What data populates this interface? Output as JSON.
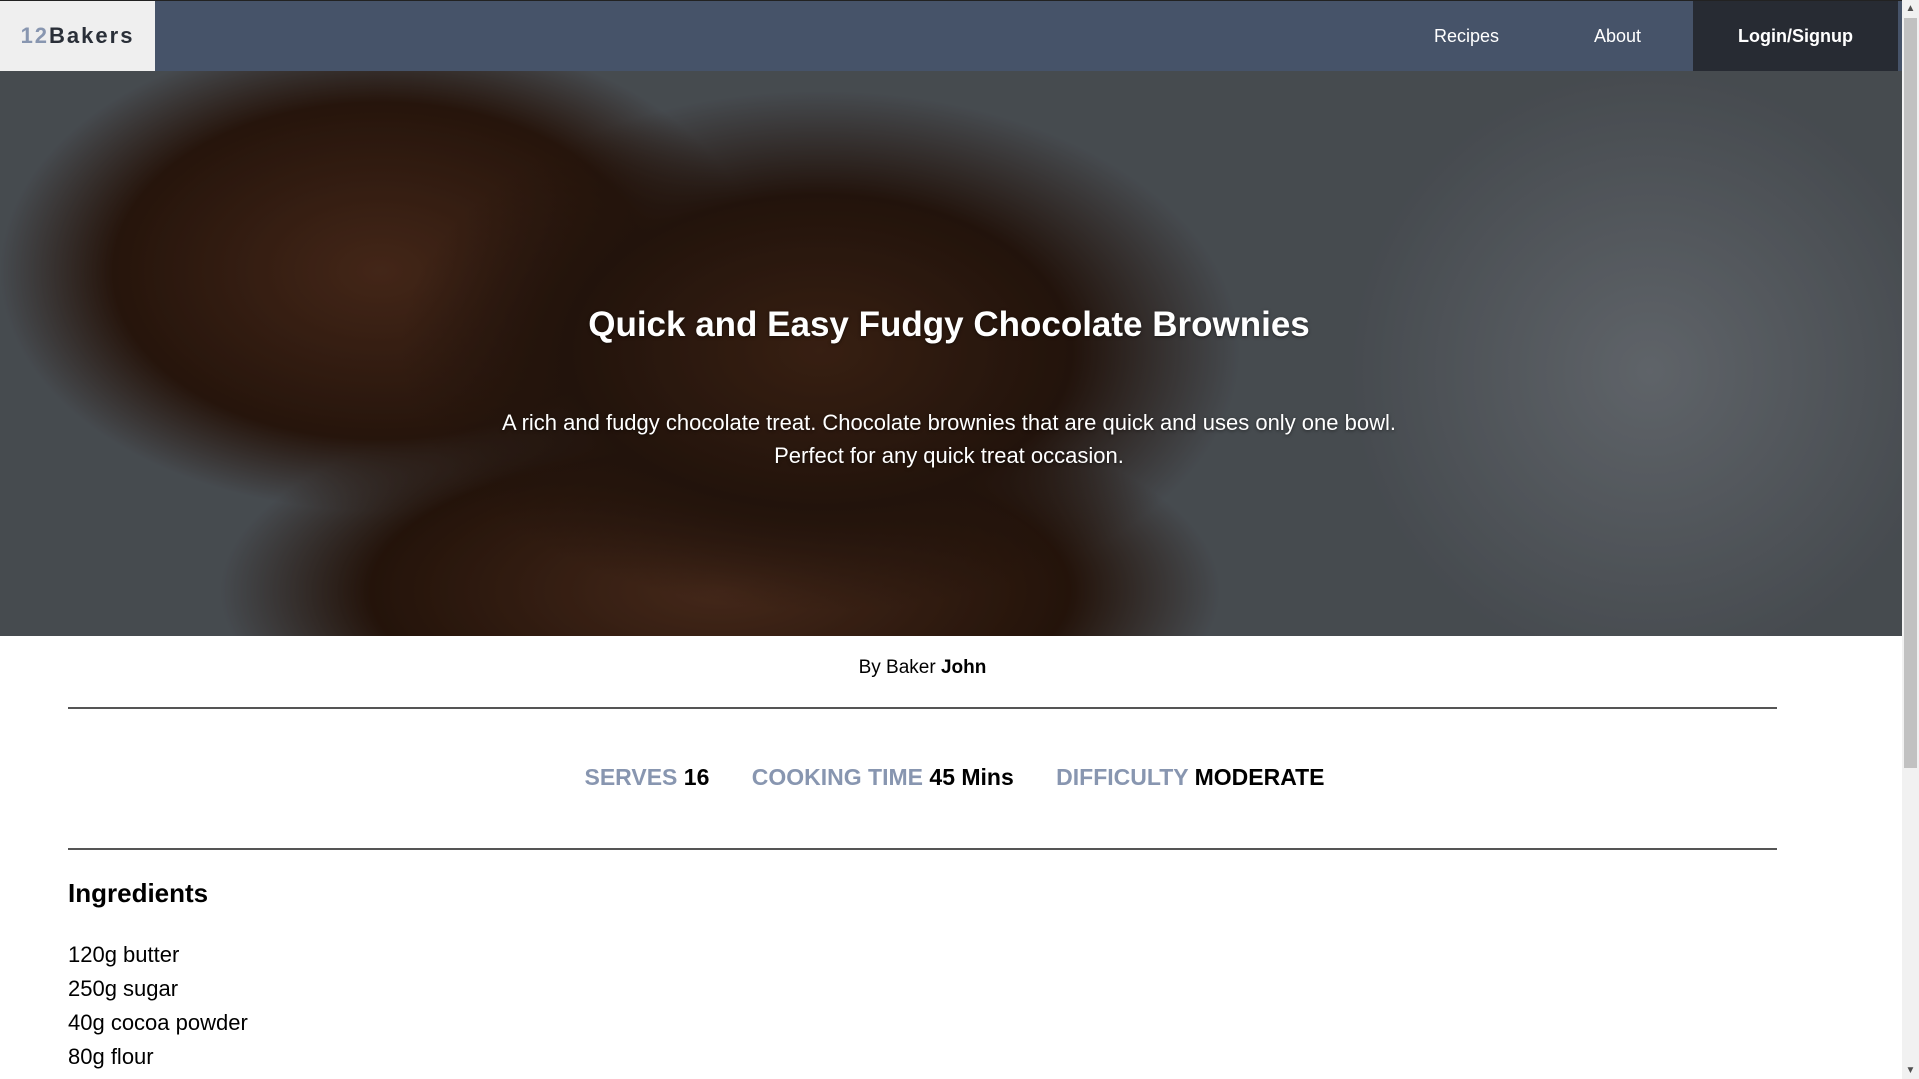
{
  "nav": {
    "logo_num": "12",
    "logo_text": "Bakers",
    "links": [
      "Recipes",
      "About"
    ],
    "login_label": "Login/Signup"
  },
  "hero": {
    "title": "Quick and Easy Fudgy Chocolate Brownies",
    "description_line1": "A rich and fudgy chocolate treat. Chocolate brownies that are quick and uses only one bowl.",
    "description_line2": "Perfect for any quick treat occasion."
  },
  "byline": {
    "prefix": "By Baker",
    "author": "John"
  },
  "stats": [
    {
      "label": "SERVES",
      "value": "16"
    },
    {
      "label": "COOKING TIME",
      "value": "45 Mins"
    },
    {
      "label": "DIFFICULTY",
      "value": "MODERATE"
    }
  ],
  "ingredients": {
    "title": "Ingredients",
    "items": [
      "120g butter",
      "250g sugar",
      "40g cocoa powder",
      "80g flour"
    ]
  },
  "colors": {
    "nav": "#465369",
    "login_bg": "#272b33",
    "stat_label": "#8896b0"
  }
}
